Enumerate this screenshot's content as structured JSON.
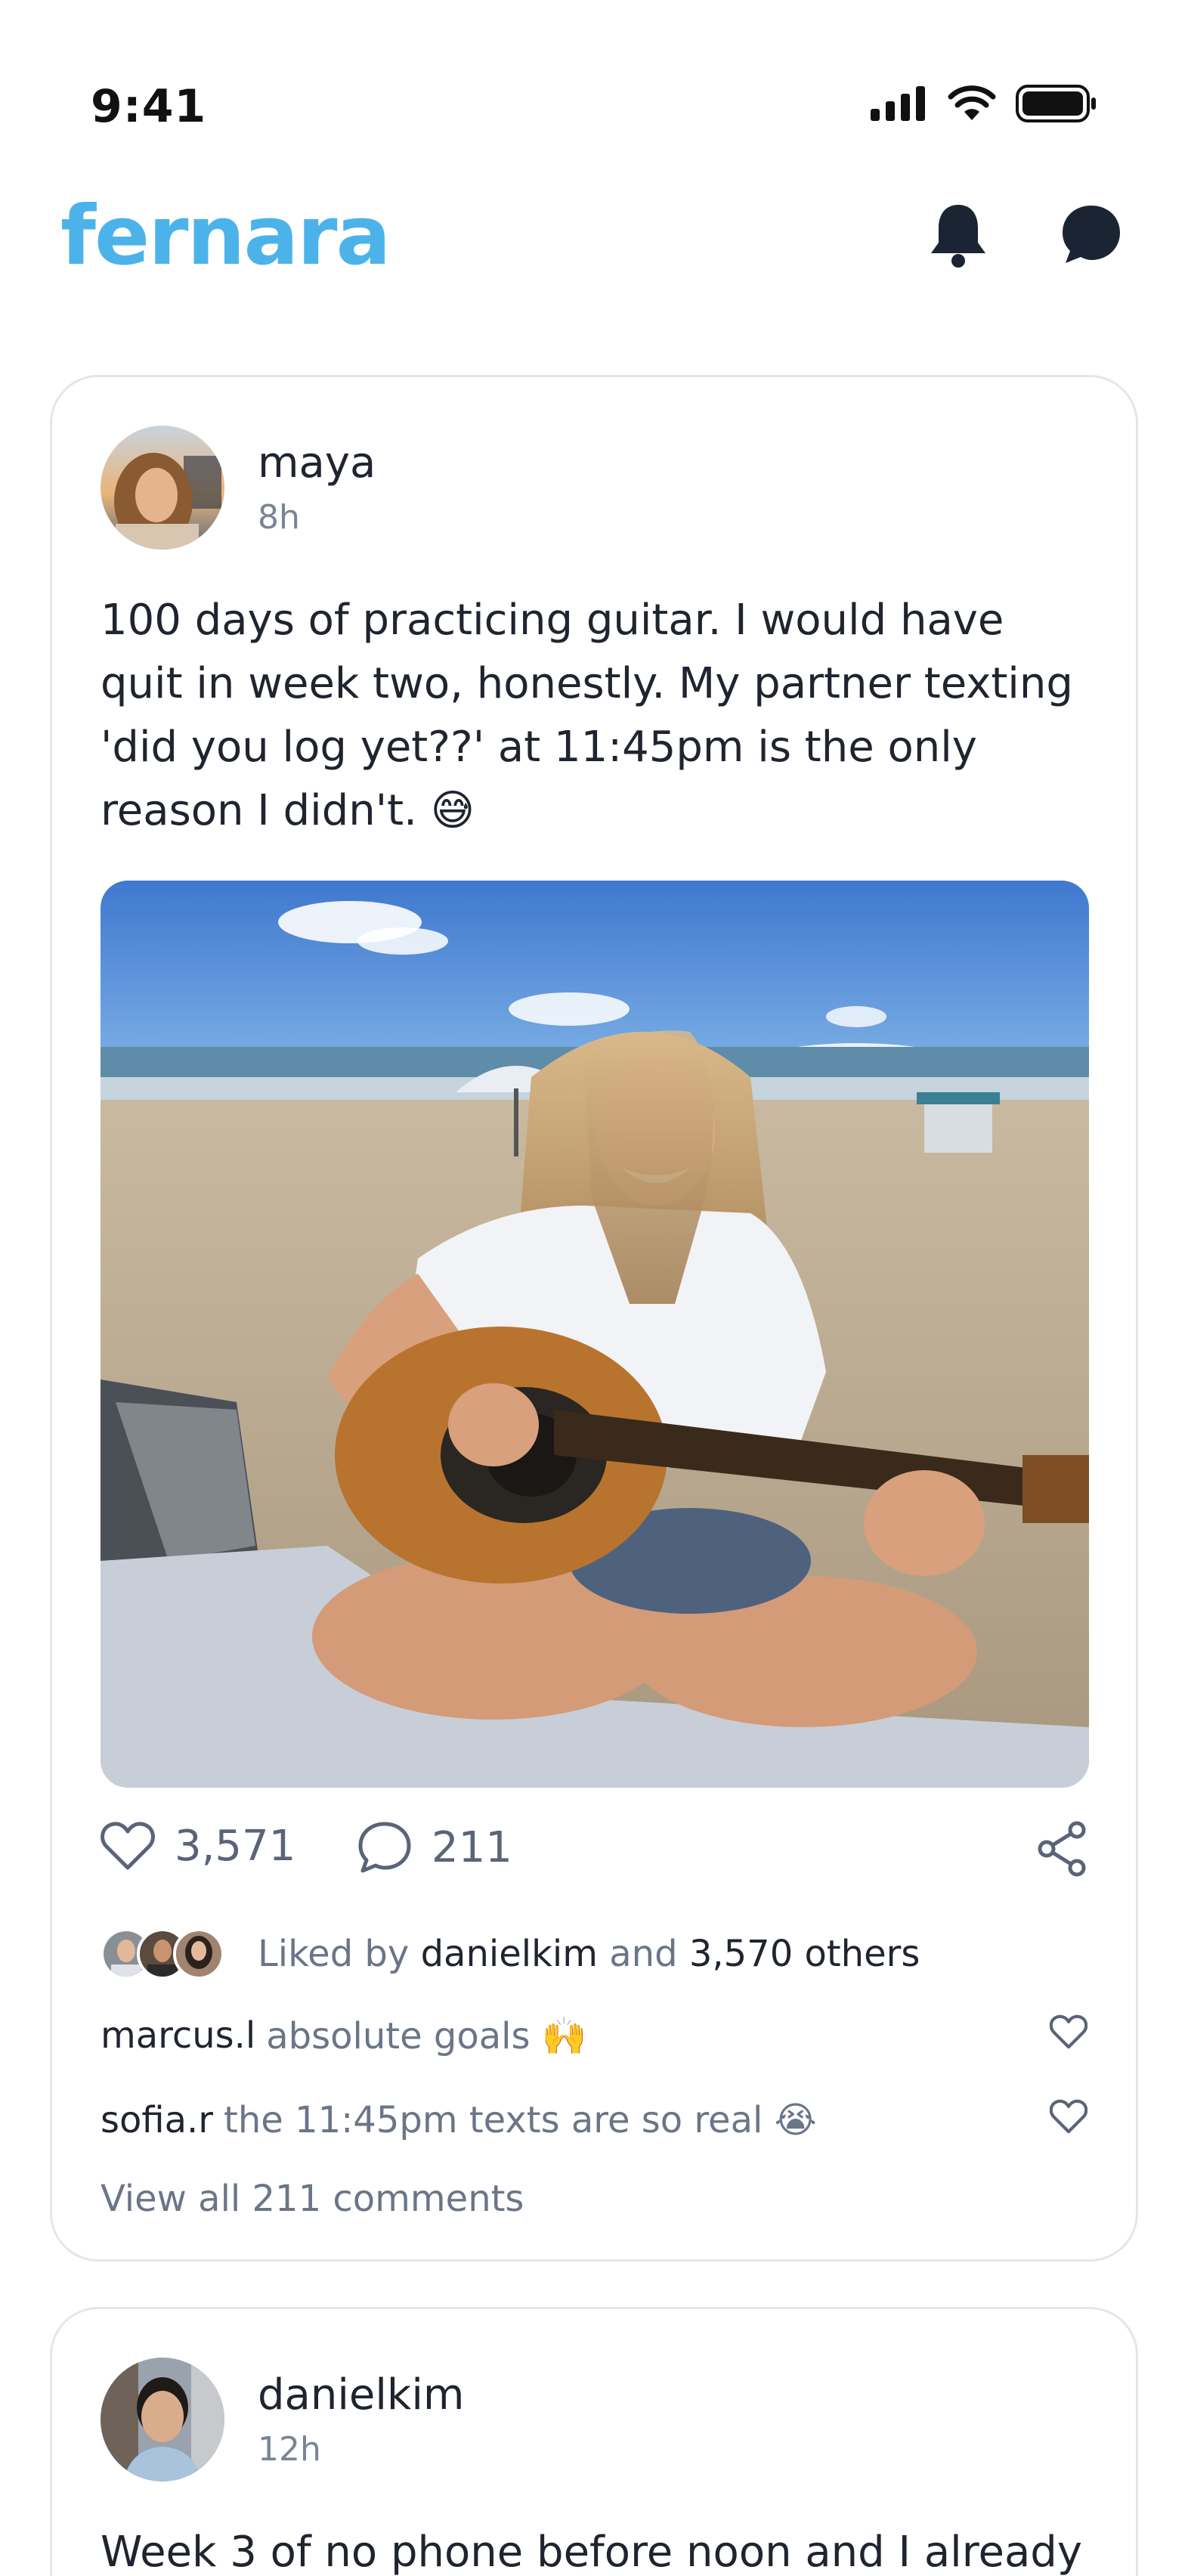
{
  "status": {
    "time": "9:41"
  },
  "header": {
    "logo": "fernara",
    "icons": [
      "bell-icon",
      "chat-bubble-icon"
    ],
    "accent_color": "#4cb3ea"
  },
  "posts": [
    {
      "author": "maya",
      "time": "8h",
      "text": "100 days of practicing guitar. I would have quit in week two, honestly. My partner texting 'did you log yet??' at 11:45pm is the only reason I didn't. 😅",
      "likes": "3,571",
      "comments": "211",
      "liked_by_prefix": "Liked by",
      "liked_by_user": "danielkim",
      "liked_by_and": "and",
      "liked_by_others": "3,570 others",
      "comment_list": [
        {
          "user": "marcus.l",
          "text": "absolute goals 🙌"
        },
        {
          "user": "sofia.r",
          "text": "the 11:45pm texts are so real 😭"
        }
      ],
      "view_all": "View all 211 comments"
    },
    {
      "author": "danielkim",
      "time": "12h",
      "text": "Week 3 of no phone before noon and I already"
    }
  ]
}
